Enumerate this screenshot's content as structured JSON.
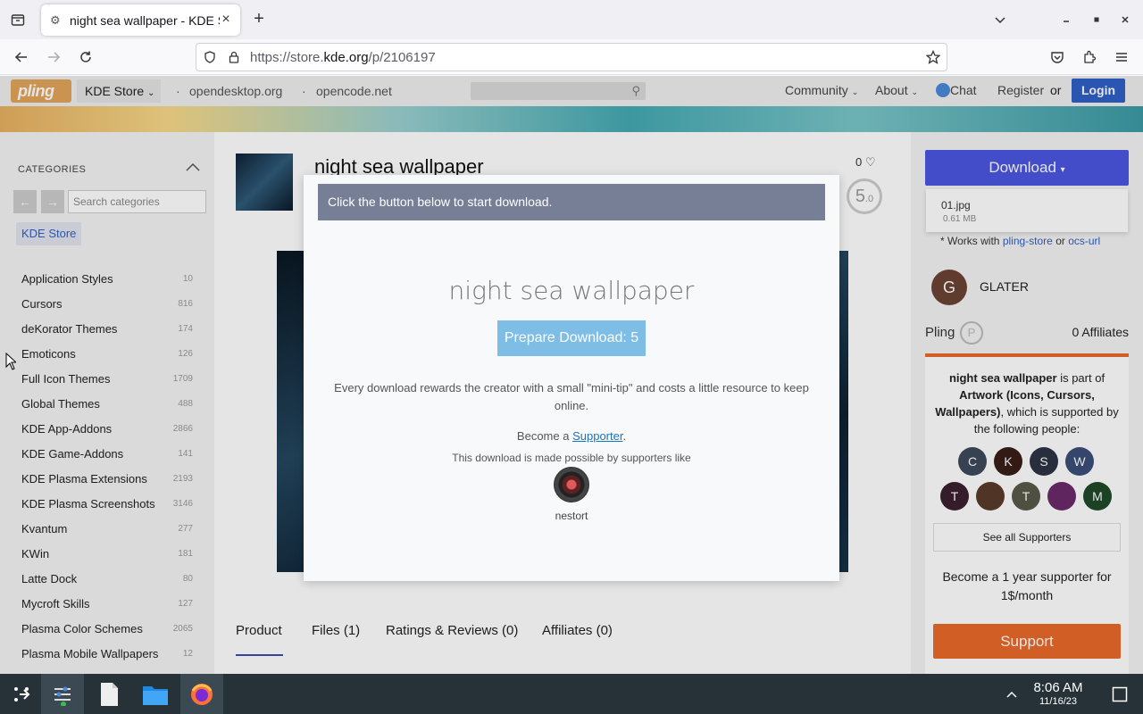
{
  "browser": {
    "tab_title": "night sea wallpaper - KDE Store",
    "url_host_prefix": "https://store.",
    "url_host": "kde.org",
    "url_path": "/p/2106197"
  },
  "site": {
    "logo": "pling",
    "store_selector": "KDE Store",
    "links": [
      "opendesktop.org",
      "opencode.net"
    ],
    "nav": {
      "community": "Community",
      "about": "About",
      "chat": "Chat",
      "register": "Register",
      "or": "or",
      "login": "Login"
    }
  },
  "sidebar": {
    "heading": "CATEGORIES",
    "search_placeholder": "Search categories",
    "current": "KDE Store",
    "categories": [
      {
        "name": "Application Styles",
        "count": "10"
      },
      {
        "name": "Cursors",
        "count": "816"
      },
      {
        "name": "deKorator Themes",
        "count": "174"
      },
      {
        "name": "Emoticons",
        "count": "126"
      },
      {
        "name": "Full Icon Themes",
        "count": "1709"
      },
      {
        "name": "Global Themes",
        "count": "488"
      },
      {
        "name": "KDE App-Addons",
        "count": "2866"
      },
      {
        "name": "KDE Game-Addons",
        "count": "141"
      },
      {
        "name": "KDE Plasma Extensions",
        "count": "2193"
      },
      {
        "name": "KDE Plasma Screenshots",
        "count": "3146"
      },
      {
        "name": "Kvantum",
        "count": "277"
      },
      {
        "name": "KWin",
        "count": "181"
      },
      {
        "name": "Latte Dock",
        "count": "80"
      },
      {
        "name": "Mycroft Skills",
        "count": "127"
      },
      {
        "name": "Plasma Color Schemes",
        "count": "2065"
      },
      {
        "name": "Plasma Mobile Wallpapers",
        "count": "12"
      }
    ]
  },
  "product": {
    "title": "night sea wallpaper",
    "likes": "0",
    "score": "5",
    "score_decimal": ".0",
    "tabs": [
      "Product",
      "Files (1)",
      "Ratings & Reviews (0)",
      "Affiliates (0)"
    ]
  },
  "right": {
    "download_label": "Download",
    "file_name": "01.jpg",
    "file_size": "0.61 MB",
    "works_prefix": "* Works with",
    "works_link1": "pling-store",
    "works_or": "or",
    "works_link2": "ocs-url",
    "creator_initial": "G",
    "creator_name": "GLATER",
    "pling_label": "Pling",
    "affiliates": "0 Affiliates",
    "support_text_bold1": "night sea wallpaper",
    "support_text_mid": " is part of ",
    "support_text_bold2": "Artwork (Icons, Cursors, Wallpapers)",
    "support_text_end": ", which is supported by the following people:",
    "supporters": [
      {
        "initial": "C",
        "color": "#3d4a5c"
      },
      {
        "initial": "K",
        "color": "#3a1e18"
      },
      {
        "initial": "S",
        "color": "#2e3447"
      },
      {
        "initial": "W",
        "color": "#3b4f7a"
      },
      {
        "initial": "T",
        "color": "#3a2030"
      },
      {
        "initial": "",
        "color": "#5a3a2a"
      },
      {
        "initial": "T",
        "color": "#5a5a4a"
      },
      {
        "initial": "",
        "color": "#6a2a6a"
      },
      {
        "initial": "M",
        "color": "#1f4a2a"
      }
    ],
    "see_all": "See all Supporters",
    "become_supporter": "Become a 1 year supporter for 1$/month",
    "support_btn": "Support"
  },
  "modal": {
    "bar_text": "Click the button below to start download.",
    "title": "night sea wallpaper",
    "prepare_btn": "Prepare Download: 5",
    "note": "Every download rewards the creator with a small \"mini-tip\" and costs a little resource to keep online.",
    "become_prefix": "Become a ",
    "become_link": "Supporter",
    "become_suffix": ".",
    "made_possible": "This download is made possible by supporters like",
    "supporter_name": "nestort"
  },
  "taskbar": {
    "time": "8:06 AM",
    "date": "11/16/23"
  }
}
